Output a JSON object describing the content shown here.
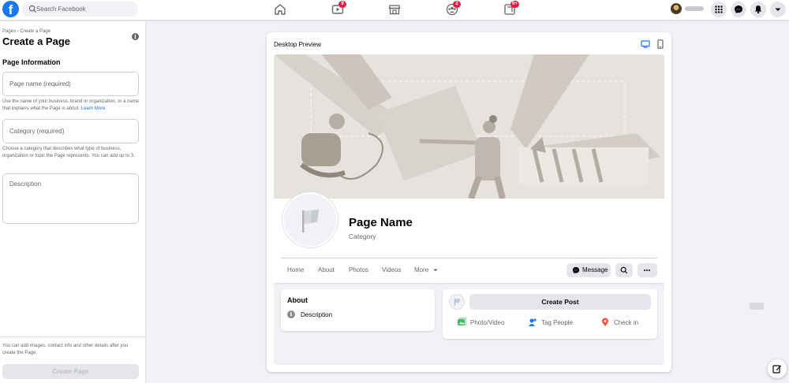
{
  "nav": {
    "search_placeholder": "Search Facebook",
    "badges": {
      "watch": "9",
      "groups": "2",
      "gaming": "9+"
    }
  },
  "left": {
    "breadcrumb": "Pages › Create a Page",
    "title": "Create a Page",
    "section": "Page Information",
    "page_name_placeholder": "Page name (required)",
    "page_name_hint": "Use the name of your business, brand or organization, or a name that explains what the Page is about.",
    "learn_more": "Learn More",
    "category_placeholder": "Category (required)",
    "category_hint": "Choose a category that describes what type of business, organization or topic the Page represents. You can add up to 3.",
    "description_placeholder": "Description",
    "footer_note": "You can add images, contact info and other details after you create the Page.",
    "create_button": "Create Page"
  },
  "preview": {
    "title": "Desktop Preview",
    "page_name": "Page Name",
    "category": "Category",
    "tabs": [
      "Home",
      "About",
      "Photos",
      "Videos",
      "More"
    ],
    "message_button": "Message",
    "about_heading": "About",
    "about_description": "Description",
    "create_post": "Create Post",
    "actions": [
      "Photo/Video",
      "Tag People",
      "Check in"
    ]
  },
  "colors": {
    "brand": "#1877f2",
    "badge": "#e41e3f",
    "background": "#f0f2f5"
  }
}
